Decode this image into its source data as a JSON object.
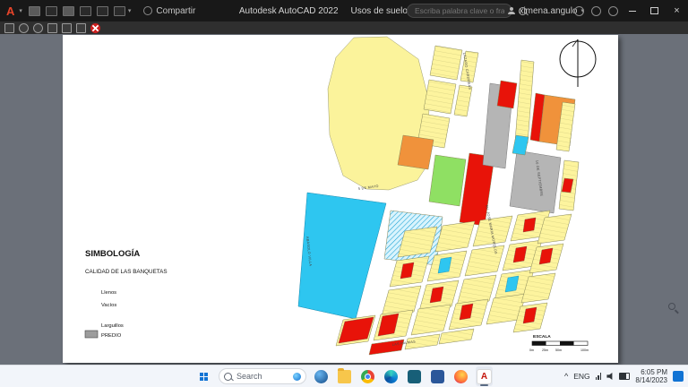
{
  "titlebar": {
    "logo": "A",
    "share_label": "Compartir",
    "app_title": "Autodesk AutoCAD 2022",
    "doc_title": "Usos de suelo.dwg",
    "search_placeholder": "Escriba palabra clave o frase",
    "user_name": "ximena.angulo"
  },
  "icons": {
    "close": "×",
    "caret_down": "▾",
    "chevron_up": "^"
  },
  "drawing": {
    "legend": {
      "title": "SIMBOLOGÍA",
      "subtitle": "CALIDAD DE LAS BANQUETAS",
      "items": [
        "Llenos",
        "Vacíos",
        "Larguillos"
      ],
      "predio_label": "PREDIO"
    },
    "scale": {
      "label": "ESCALA",
      "ticks": [
        "0m",
        "25m",
        "50m",
        "100m"
      ]
    },
    "streets": [
      "LÁZARO CÁRDENAS",
      "5 DE MAYO",
      "AV. JOSÉ MARÍA MORELOS",
      "16 DE SEPTIEMBRE",
      "ABASOLO VILLA",
      "LAS PALMAS"
    ],
    "colors": {
      "parcel_yellow": "#fdf49e",
      "solid_red": "#e81309",
      "solid_cyan": "#2ec6f0",
      "solid_orange": "#f0923b",
      "solid_green": "#8fe063",
      "solid_gray": "#b5b5b5"
    }
  },
  "taskbar": {
    "search_placeholder": "Search",
    "lang": "ENG",
    "time": "6:05 PM",
    "date": "8/14/2023"
  }
}
